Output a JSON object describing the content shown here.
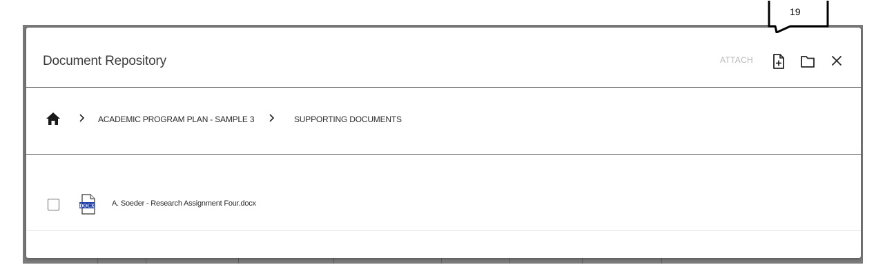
{
  "annotation": {
    "number": "19"
  },
  "modal": {
    "title": "Document Repository",
    "attach_label": "ATTACH",
    "icons": {
      "new_document": "add-document-icon",
      "new_folder": "folder-icon",
      "close": "close-icon"
    }
  },
  "breadcrumb": {
    "home_icon": "home-icon",
    "items": [
      {
        "label": "ACADEMIC PROGRAM PLAN - SAMPLE 3"
      },
      {
        "label": "SUPPORTING DOCUMENTS"
      }
    ]
  },
  "files": [
    {
      "name": "A. Soeder - Research Assignment Four.docx",
      "type_badge": "DOCX",
      "checked": false
    }
  ],
  "colors": {
    "divider": "#5a5a5a",
    "attach_disabled": "#b9b9b9",
    "docx_blue": "#1f3fa8",
    "backdrop": "#7a7a7a"
  }
}
